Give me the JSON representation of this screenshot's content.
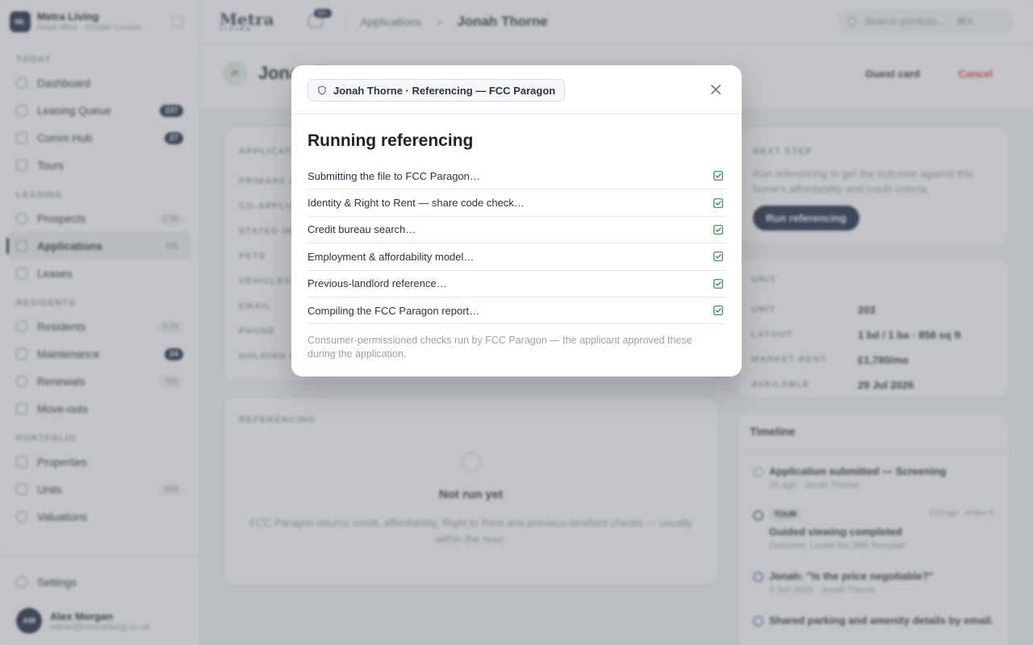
{
  "brand": {
    "initials": "ML",
    "name": "Metra Living",
    "subtitle": "Head office · Greater London"
  },
  "nav": {
    "sections": [
      {
        "label": "TODAY",
        "items": [
          {
            "label": "Dashboard",
            "count": ""
          },
          {
            "label": "Leasing Queue",
            "count": "237"
          },
          {
            "label": "Comm Hub",
            "count": "27"
          },
          {
            "label": "Tours",
            "count": ""
          }
        ]
      },
      {
        "label": "LEASING",
        "items": [
          {
            "label": "Prospects",
            "count": "2.3k"
          },
          {
            "label": "Applications",
            "count": "311"
          },
          {
            "label": "Leases",
            "count": ""
          }
        ]
      },
      {
        "label": "RESIDENTS",
        "items": [
          {
            "label": "Residents",
            "count": "8.7k"
          },
          {
            "label": "Maintenance",
            "count": "24"
          },
          {
            "label": "Renewals",
            "count": "755"
          },
          {
            "label": "Move-outs",
            "count": ""
          }
        ]
      },
      {
        "label": "PORTFOLIO",
        "items": [
          {
            "label": "Properties",
            "count": ""
          },
          {
            "label": "Units",
            "count": "336"
          },
          {
            "label": "Valuations",
            "count": ""
          }
        ]
      }
    ],
    "settings": "Settings"
  },
  "user": {
    "initials": "AM",
    "name": "Alex Morgan",
    "email": "admin@metraliving.co.uk"
  },
  "topbar": {
    "logo": "Metra",
    "logo_sub": "LIVING",
    "chat_badge": "99+",
    "breadcrumb_parent": "Applications",
    "breadcrumb_sep": ">",
    "breadcrumb_current": "Jonah Thorne",
    "search_placeholder": "Search portfolio…",
    "search_shortcut": "⌘K"
  },
  "applicant": {
    "initials": "JT",
    "title": "Jonah Thorne",
    "guest_card": "Guest card",
    "cancel": "Cancel"
  },
  "application_card": {
    "title": "APPLICATION",
    "keys": [
      "PRIMARY APPLICANT",
      "CO-APPLICANT",
      "STATED INCOME",
      "PETS",
      "VEHICLES",
      "EMAIL",
      "PHONE",
      "HOLDING DEPOSIT"
    ]
  },
  "referencing_card": {
    "title": "REFERENCING",
    "empty_title": "Not run yet",
    "empty_text": "FCC Paragon returns credit, affordability, Right to Rent and previous-landlord checks — usually within the hour."
  },
  "next_step": {
    "title": "NEXT STEP",
    "text": "Run referencing to get the outcome against this home's affordability and credit criteria.",
    "button": "Run referencing"
  },
  "unit_card": {
    "title": "UNIT",
    "rows": [
      {
        "key": "UNIT",
        "value": "203"
      },
      {
        "key": "LAYOUT",
        "value": "1 bd / 1 ba · 858 sq ft"
      },
      {
        "key": "MARKET RENT",
        "value": "£1,780/mo"
      },
      {
        "key": "AVAILABLE",
        "value": "29 Jul 2026"
      }
    ]
  },
  "timeline": {
    "title": "Timeline",
    "items": [
      {
        "title": "Application submitted — Screening",
        "sub": "2d ago · Jonah Thorne"
      },
      {
        "tag": "TOUR",
        "meta": "12d ago · Andre K.",
        "title": "Guided viewing completed",
        "sub": "Outcome: Loved the 2BR floorplan"
      },
      {
        "title": "Jonah: \"Is the price negotiable?\"",
        "sub": "3 Jun 2026 · Jonah Thorne"
      },
      {
        "title": "Shared parking and amenity details by email.",
        "sub": ""
      }
    ]
  },
  "modal": {
    "context": "Jonah Thorne · Referencing — FCC Paragon",
    "title": "Running referencing",
    "steps": [
      {
        "label": "Submitting the file to FCC Paragon…",
        "done": true
      },
      {
        "label": "Identity & Right to Rent — share code check…",
        "done": true
      },
      {
        "label": "Credit bureau search…",
        "done": true
      },
      {
        "label": "Employment & affordability model…",
        "done": true
      },
      {
        "label": "Previous-landlord reference…",
        "done": true
      },
      {
        "label": "Compiling the FCC Paragon report…",
        "done": true
      }
    ],
    "footnote": "Consumer-permissioned checks run by FCC Paragon — the applicant approved these during the application.",
    "check_color": "#2f8a4c"
  }
}
